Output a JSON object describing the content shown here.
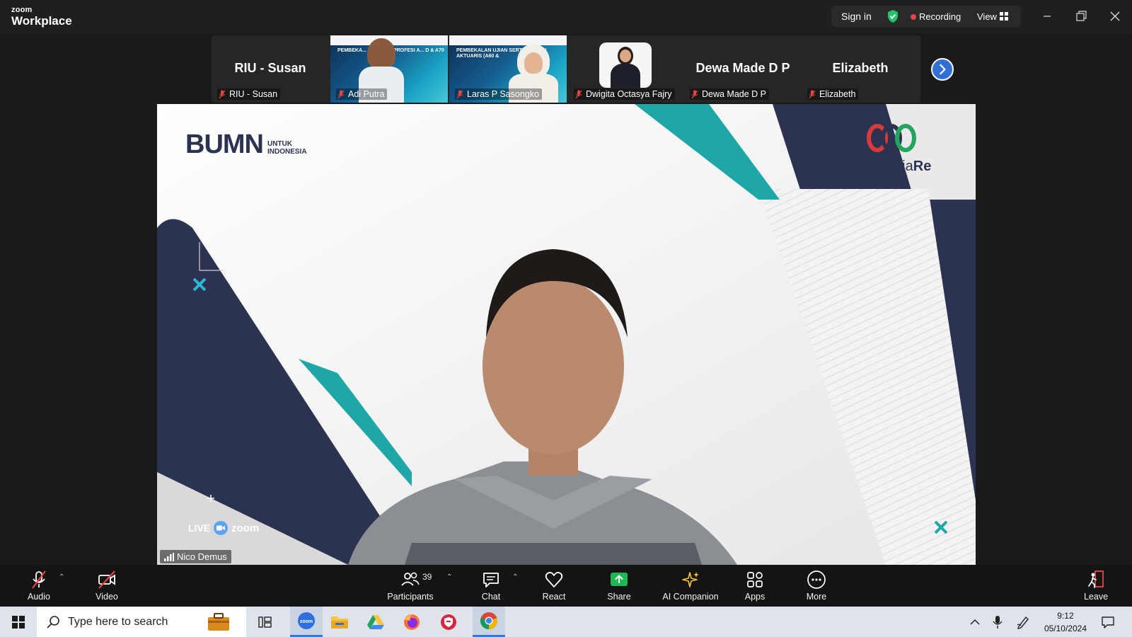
{
  "app": {
    "brand_top": "zoom",
    "brand_bottom": "Workplace"
  },
  "titlebar": {
    "sign_in": "Sign in",
    "recording": "Recording",
    "view": "View",
    "controls": [
      "minimize-icon",
      "restore-icon",
      "close-icon"
    ]
  },
  "thumbnails": [
    {
      "display": "RIU - Susan",
      "name": "RIU - Susan",
      "video": false
    },
    {
      "display": "",
      "name": "Adi Putra",
      "video": true,
      "slide_text": "PEMBEKA... RTIFIKASI PROFESI A... D & A70"
    },
    {
      "display": "",
      "name": "Laras P Sasongko",
      "video": true,
      "slide_text": "PEMBEKALAN UJIAN SERTI PROFESI AKTUARIS (A60 &"
    },
    {
      "display": "",
      "name": "Dwigita Octasya Fajry",
      "video": false,
      "avatar": true
    },
    {
      "display": "Dewa Made D P",
      "name": "Dewa Made D P",
      "video": false
    },
    {
      "display": "Elizabeth",
      "name": "Elizabeth",
      "video": false
    }
  ],
  "stage": {
    "speaker": "Nico Demus",
    "logo_left_main": "BUMN",
    "logo_left_sub1": "UNTUK",
    "logo_left_sub2": "INDONESIA",
    "logo_right_text_a": "Indonesia",
    "logo_right_text_b": "Re",
    "live_text": "LIVE",
    "zoom_text": "zoom"
  },
  "toolbar": {
    "audio": "Audio",
    "video": "Video",
    "participants": "Participants",
    "participants_count": "39",
    "chat": "Chat",
    "react": "React",
    "share": "Share",
    "ai": "AI Companion",
    "apps": "Apps",
    "more": "More",
    "leave": "Leave"
  },
  "taskbar": {
    "search_placeholder": "Type here to search",
    "time": "9:12",
    "date": "05/10/2024"
  },
  "colors": {
    "accent_blue": "#2f6fd6",
    "share_green": "#1db954",
    "mute_red": "#e84545",
    "teal": "#1fa7a8",
    "navy": "#2b3350"
  }
}
